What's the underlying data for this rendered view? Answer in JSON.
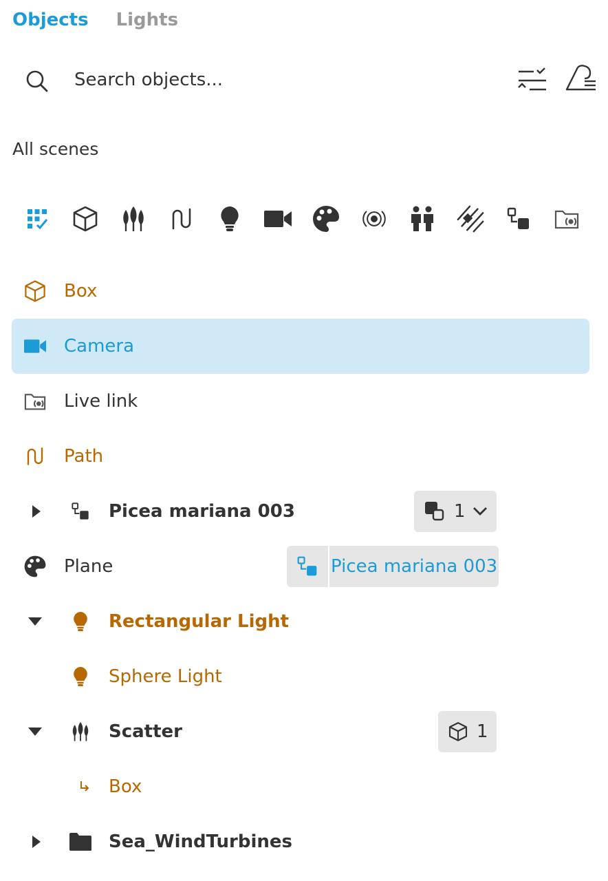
{
  "tabs": {
    "objects": "Objects",
    "lights": "Lights"
  },
  "search": {
    "placeholder": "Search objects..."
  },
  "scenes_label": "All scenes",
  "filters": [
    "all-filter-icon",
    "box-icon",
    "scatter-icon",
    "path-icon",
    "light-icon",
    "camera-icon",
    "material-icon",
    "radar-icon",
    "people-icon",
    "lines-icon",
    "link-icon",
    "live-link-folder-icon"
  ],
  "colors": {
    "accent": "#1b9bd7",
    "orange": "#b86800",
    "selected_bg": "#cfe9f6",
    "chip_bg": "#e6e6e6",
    "text": "#333333"
  },
  "tree": [
    {
      "label": "Box",
      "icon": "box-icon",
      "color": "orange",
      "bold": false,
      "indent": 0,
      "caret": "none"
    },
    {
      "label": "Camera",
      "icon": "camera-icon",
      "color": "blue",
      "bold": false,
      "indent": 0,
      "caret": "none",
      "selected": true
    },
    {
      "label": "Live link",
      "icon": "live-link-folder-icon",
      "color": "dark",
      "bold": false,
      "indent": 0,
      "caret": "none"
    },
    {
      "label": "Path",
      "icon": "path-icon",
      "color": "orange",
      "bold": false,
      "indent": 0,
      "caret": "none"
    },
    {
      "label": "Picea mariana 003",
      "icon": "link-icon",
      "color": "dark",
      "bold": true,
      "indent": 1,
      "caret": "collapsed",
      "badge_count": "1"
    },
    {
      "label": "Plane",
      "icon": "material-icon",
      "color": "dark",
      "bold": false,
      "indent": 0,
      "caret": "none",
      "material_link": "Picea mariana 003"
    },
    {
      "label": "Rectangular Light",
      "icon": "light-icon",
      "color": "orange",
      "bold": true,
      "indent": 1,
      "caret": "expanded"
    },
    {
      "label": "Sphere Light",
      "icon": "light-icon",
      "color": "orange",
      "bold": false,
      "indent": 1,
      "caret": "none"
    },
    {
      "label": "Scatter",
      "icon": "scatter-icon",
      "color": "dark",
      "bold": true,
      "indent": 1,
      "caret": "expanded",
      "badge_count": "1"
    },
    {
      "label": "Box",
      "icon": "child-arrow-icon",
      "color": "orange",
      "bold": false,
      "indent": 1,
      "caret": "none"
    },
    {
      "label": "Sea_WindTurbines",
      "icon": "folder-icon",
      "color": "dark",
      "bold": true,
      "indent": 1,
      "caret": "collapsed"
    }
  ]
}
